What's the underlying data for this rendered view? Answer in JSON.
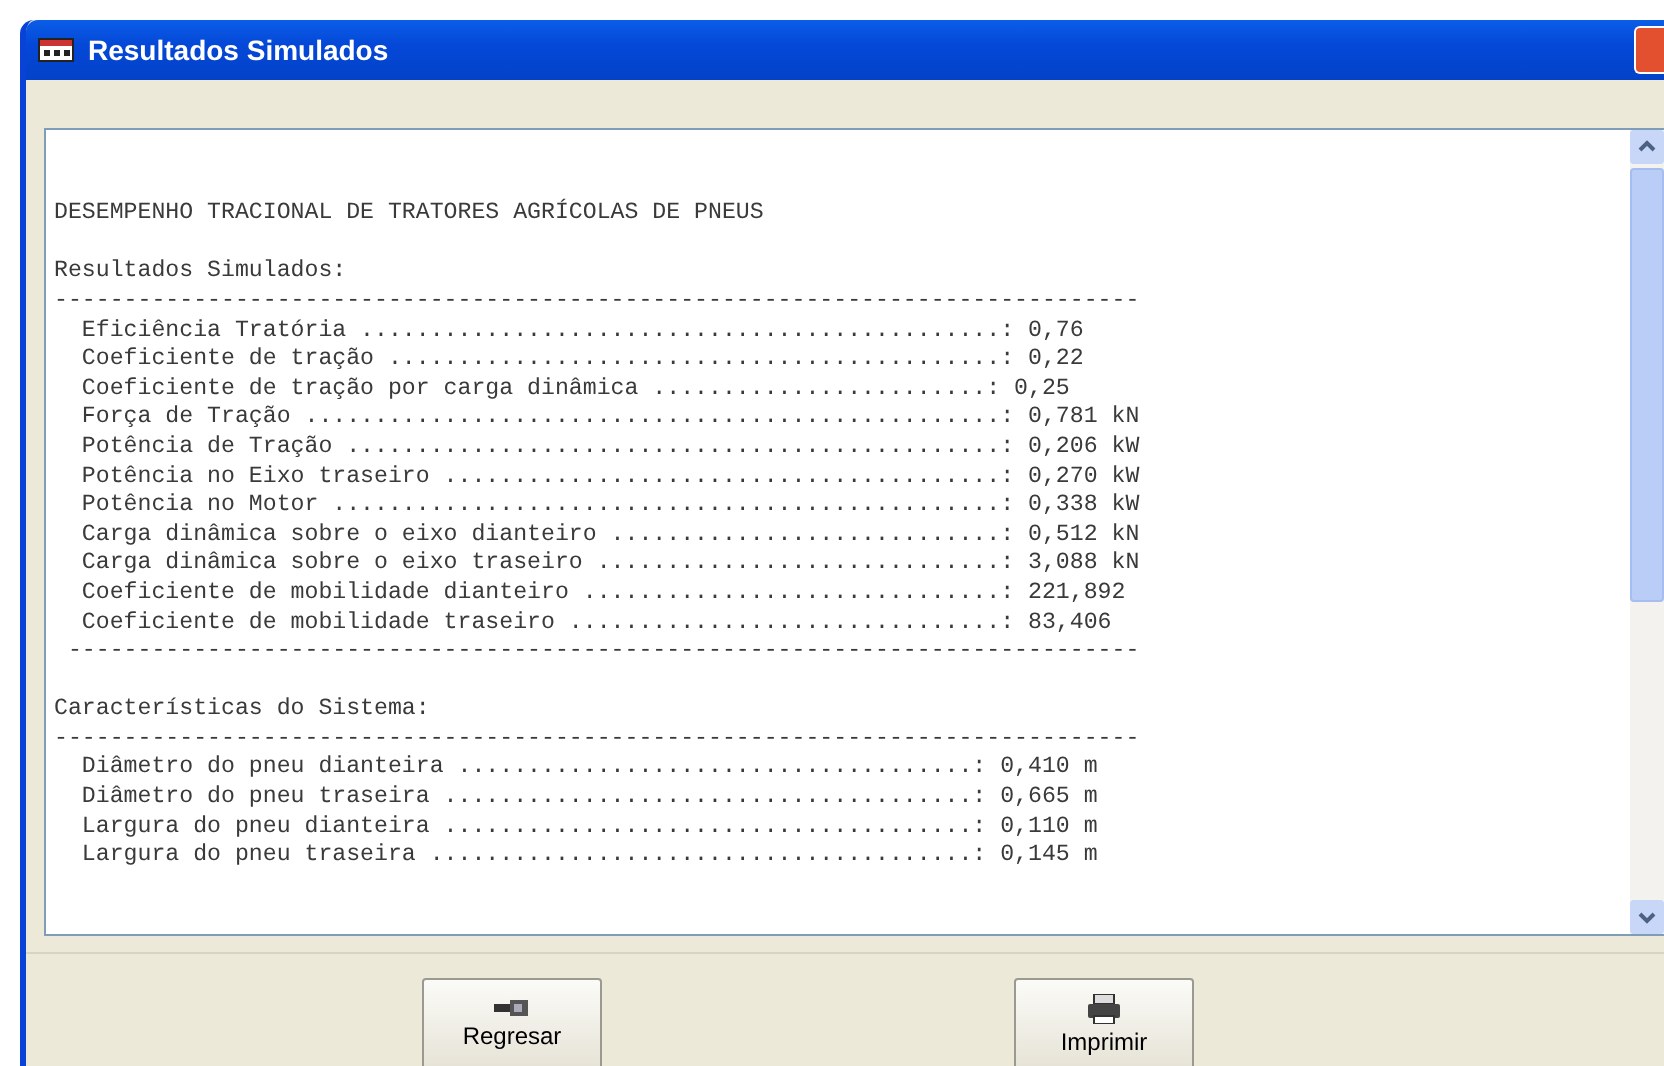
{
  "window": {
    "title": "Resultados Simulados"
  },
  "report": {
    "lines": [
      {
        "kind": "text",
        "text": "DESEMPENHO TRACIONAL DE TRATORES AGRÍCOLAS DE PNEUS"
      },
      {
        "kind": "blank"
      },
      {
        "kind": "text",
        "text": "Resultados Simulados:"
      },
      {
        "kind": "text",
        "text": "------------------------------------------------------------------------------"
      },
      {
        "kind": "text",
        "text": "  Eficiência Tratória ..............................................: 0,76"
      },
      {
        "kind": "text",
        "text": "  Coeficiente de tração ............................................: 0,22"
      },
      {
        "kind": "text",
        "text": "  Coeficiente de tração por carga dinâmica ........................: 0,25"
      },
      {
        "kind": "text",
        "text": "  Força de Tração ..................................................: 0,781 kN"
      },
      {
        "kind": "text",
        "text": "  Potência de Tração ...............................................: 0,206 kW"
      },
      {
        "kind": "text",
        "text": "  Potência no Eixo traseiro ........................................: 0,270 kW"
      },
      {
        "kind": "text",
        "text": "  Potência no Motor ................................................: 0,338 kW"
      },
      {
        "kind": "text",
        "text": "  Carga dinâmica sobre o eixo dianteiro ............................: 0,512 kN"
      },
      {
        "kind": "text",
        "text": "  Carga dinâmica sobre o eixo traseiro .............................: 3,088 kN"
      },
      {
        "kind": "text",
        "text": "  Coeficiente de mobilidade dianteiro ..............................: 221,892"
      },
      {
        "kind": "text",
        "text": "  Coeficiente de mobilidade traseiro ...............................: 83,406"
      },
      {
        "kind": "text",
        "text": " -----------------------------------------------------------------------------"
      },
      {
        "kind": "blank"
      },
      {
        "kind": "text",
        "text": "Características do Sistema:"
      },
      {
        "kind": "text",
        "text": "------------------------------------------------------------------------------"
      },
      {
        "kind": "text",
        "text": "  Diâmetro do pneu dianteira .....................................: 0,410 m"
      },
      {
        "kind": "text",
        "text": "  Diâmetro do pneu traseira ......................................: 0,665 m"
      },
      {
        "kind": "text",
        "text": "  Largura do pneu dianteira ......................................: 0,110 m"
      },
      {
        "kind": "text",
        "text": "  Largura do pneu traseira .......................................: 0,145 m"
      }
    ]
  },
  "buttons": [
    {
      "kind": "back",
      "label": "Regresar"
    },
    {
      "kind": "print",
      "label": "Imprimir"
    }
  ]
}
